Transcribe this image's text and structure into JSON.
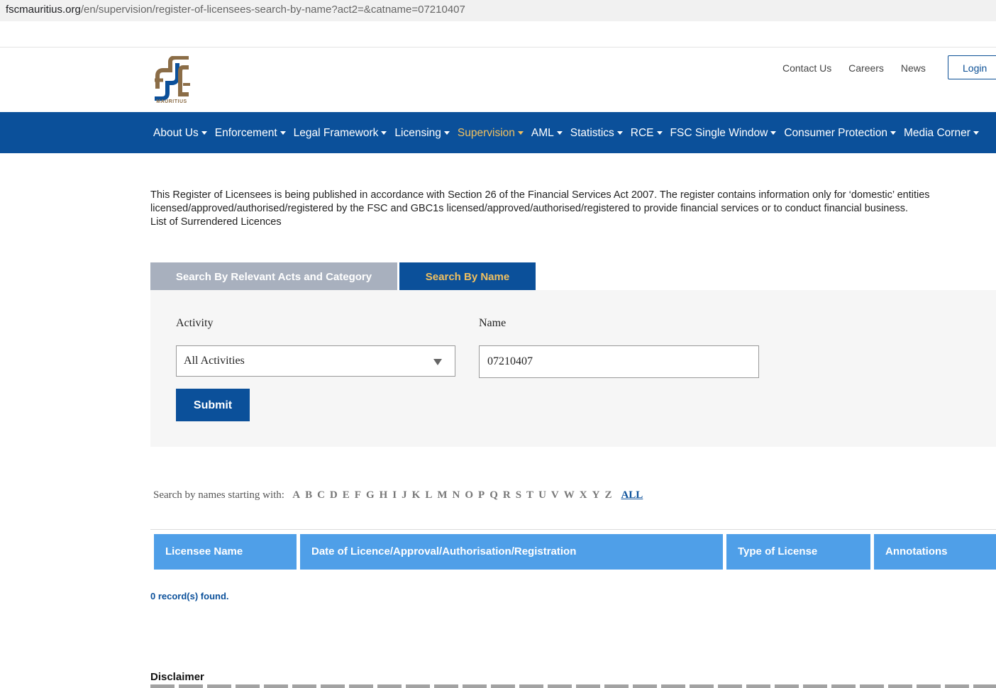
{
  "browser": {
    "url_host": "fscmauritius.org",
    "url_path": "/en/supervision/register-of-licensees-search-by-name?act2=&catname=07210407"
  },
  "header": {
    "logo_text": "MAURITIUS",
    "top_links": [
      "Contact Us",
      "Careers",
      "News"
    ],
    "login_label": "Login"
  },
  "nav": {
    "items": [
      {
        "label": "About Us",
        "active": false
      },
      {
        "label": "Enforcement",
        "active": false
      },
      {
        "label": "Legal Framework",
        "active": false
      },
      {
        "label": "Licensing",
        "active": false
      },
      {
        "label": "Supervision",
        "active": true
      },
      {
        "label": "AML",
        "active": false
      },
      {
        "label": "Statistics",
        "active": false
      },
      {
        "label": "RCE",
        "active": false
      },
      {
        "label": "FSC Single Window",
        "active": false
      },
      {
        "label": "Consumer Protection",
        "active": false
      },
      {
        "label": "Media Corner",
        "active": false
      }
    ]
  },
  "intro": {
    "line1": "This Register of Licensees is being published in accordance with Section 26 of the Financial Services Act 2007. The register contains information only for ‘domestic’ entities",
    "line2": "licensed/approved/authorised/registered by the FSC and GBC1s licensed/approved/authorised/registered to provide financial services or to conduct financial business.",
    "surrendered_link": "List of Surrendered Licences"
  },
  "tabs": {
    "by_category": "Search By Relevant Acts and Category",
    "by_name": "Search By Name"
  },
  "form": {
    "activity_label": "Activity",
    "activity_value": "All Activities",
    "name_label": "Name",
    "name_value": "07210407",
    "submit_label": "Submit"
  },
  "alpha": {
    "label": "Search by names starting with:",
    "letters": [
      "A",
      "B",
      "C",
      "D",
      "E",
      "F",
      "G",
      "H",
      "I",
      "J",
      "K",
      "L",
      "M",
      "N",
      "O",
      "P",
      "Q",
      "R",
      "S",
      "T",
      "U",
      "V",
      "W",
      "X",
      "Y",
      "Z"
    ],
    "all_label": "ALL"
  },
  "table": {
    "headers": [
      "Licensee Name",
      "Date of Licence/Approval/Authorisation/Registration",
      "Type of License",
      "Annotations"
    ]
  },
  "results": {
    "records_text": "0 record(s) found."
  },
  "footer": {
    "disclaimer_title": "Disclaimer"
  },
  "colors": {
    "brand_blue": "#0b509a",
    "header_blue": "#4f9fe8",
    "active_gold": "#f0c060",
    "inactive_tab": "#a8b0be"
  }
}
